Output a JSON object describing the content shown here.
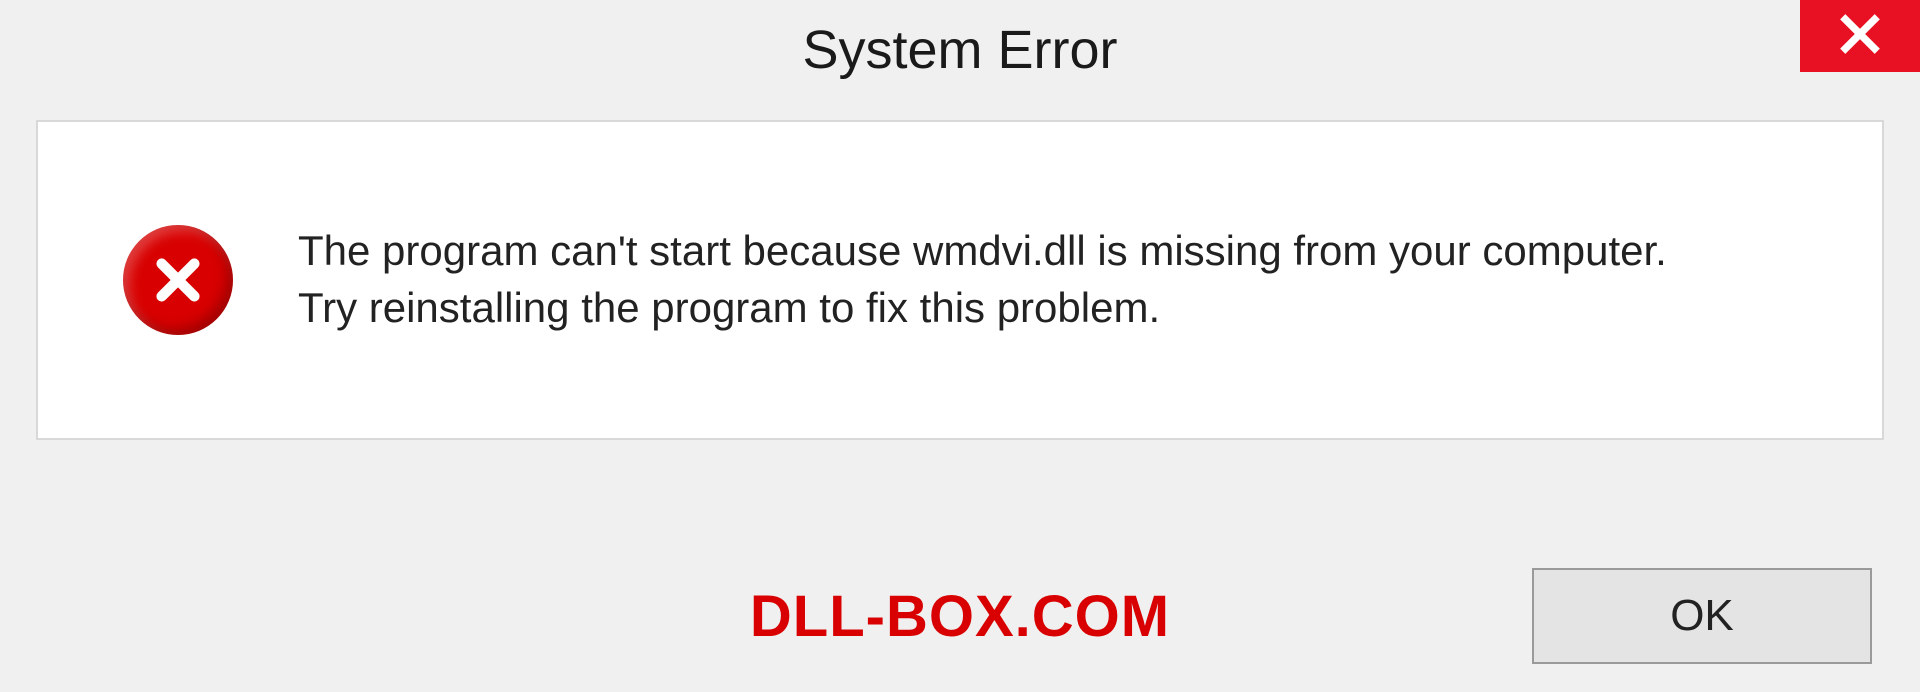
{
  "titlebar": {
    "title": "System Error"
  },
  "message": {
    "line1": "The program can't start because wmdvi.dll is missing from your computer.",
    "line2": "Try reinstalling the program to fix this problem."
  },
  "footer": {
    "brand": "DLL-BOX.COM",
    "ok_label": "OK"
  },
  "colors": {
    "close_bg": "#e81123",
    "error_red": "#d80000",
    "panel_border": "#d8d8d8"
  }
}
